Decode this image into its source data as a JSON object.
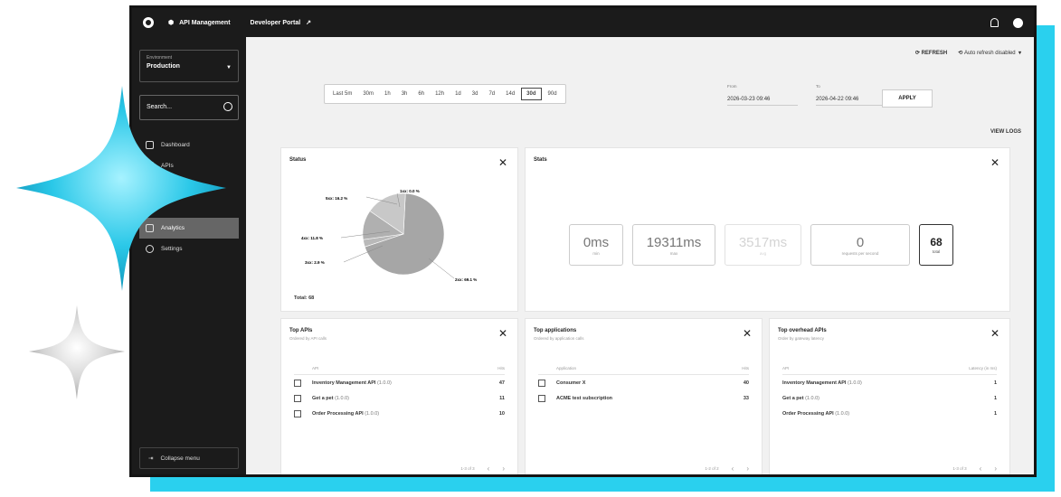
{
  "colors": {
    "accent": "#2ad0ee",
    "sidebar": "#1b1b1b",
    "pie": "#a6a6a6"
  },
  "topbar": {
    "app_name": "API Management",
    "portal_link": "Developer Portal",
    "notifications_icon": "bell-icon",
    "user_icon": "avatar"
  },
  "sidebar": {
    "environment_label": "Environment",
    "environment_value": "Production",
    "search_placeholder": "Search...",
    "items": [
      {
        "label": "Dashboard",
        "icon": "home-icon"
      },
      {
        "label": "APIs",
        "icon": "api-icon"
      },
      {
        "label": "",
        "icon": ""
      },
      {
        "label": "",
        "icon": ""
      },
      {
        "label": "Analytics",
        "icon": "chart-icon",
        "active": true
      },
      {
        "label": "Settings",
        "icon": "gear-icon"
      }
    ],
    "collapse_label": "Collapse menu"
  },
  "toolbar": {
    "refresh_label": "REFRESH",
    "auto_refresh_label": "Auto refresh disabled"
  },
  "time_ranges": [
    "Last 5m",
    "30m",
    "1h",
    "3h",
    "6h",
    "12h",
    "1d",
    "3d",
    "7d",
    "14d",
    "30d",
    "90d"
  ],
  "selected_range": "30d",
  "from": {
    "label": "From",
    "value": "2026-03-23 09:46"
  },
  "to": {
    "label": "To",
    "value": "2026-04-22 09:46"
  },
  "apply_label": "APPLY",
  "view_logs_label": "VIEW LOGS",
  "status_card": {
    "title": "Status",
    "total": "Total: 68",
    "labels": {
      "s1xx": "1xx: 0.0 %",
      "s2xx": "2xx: 69.1 %",
      "s3xx": "3xx: 2.9 %",
      "s4xx": "4xx: 11.8 %",
      "s5xx": "5xx: 16.2 %"
    }
  },
  "chart_data": {
    "type": "pie",
    "title": "Status",
    "categories": [
      "1xx",
      "2xx",
      "3xx",
      "4xx",
      "5xx"
    ],
    "values": [
      0.0,
      69.1,
      2.9,
      11.8,
      16.2
    ],
    "unit": "%",
    "total": 68
  },
  "stats_card": {
    "title": "Stats",
    "items": [
      {
        "value": "0ms",
        "label": "min"
      },
      {
        "value": "19311ms",
        "label": "max"
      },
      {
        "value": "3517ms",
        "label": "avg"
      },
      {
        "value": "0",
        "label": "requests per second"
      },
      {
        "value": "68",
        "label": "total"
      }
    ]
  },
  "top_apis": {
    "title": "Top APIs",
    "subtitle": "Ordered by API calls",
    "columns": [
      "API",
      "Hits"
    ],
    "rows": [
      {
        "name": "Inventory Management API",
        "version": "(1.0.0)",
        "value": "47"
      },
      {
        "name": "Get a pet",
        "version": "(1.0.0)",
        "value": "11"
      },
      {
        "name": "Order Processing API",
        "version": "(1.0.0)",
        "value": "10"
      }
    ],
    "pagination": "1-3 of 3"
  },
  "top_applications": {
    "title": "Top applications",
    "subtitle": "Ordered by application calls",
    "columns": [
      "Application",
      "Hits"
    ],
    "rows": [
      {
        "name": "Consumer X",
        "value": "40"
      },
      {
        "name": "ACME test subscription",
        "value": "33"
      }
    ],
    "pagination": "1-2 of 2"
  },
  "top_overhead": {
    "title": "Top overhead APIs",
    "subtitle": "Order by gateway latency",
    "columns": [
      "API",
      "Latency (in ms)"
    ],
    "rows": [
      {
        "name": "Inventory Management API",
        "version": "(1.0.0)",
        "value": "1"
      },
      {
        "name": "Get a pet",
        "version": "(1.0.0)",
        "value": "1"
      },
      {
        "name": "Order Processing API",
        "version": "(1.0.0)",
        "value": "1"
      }
    ],
    "pagination": "1-3 of 3"
  }
}
